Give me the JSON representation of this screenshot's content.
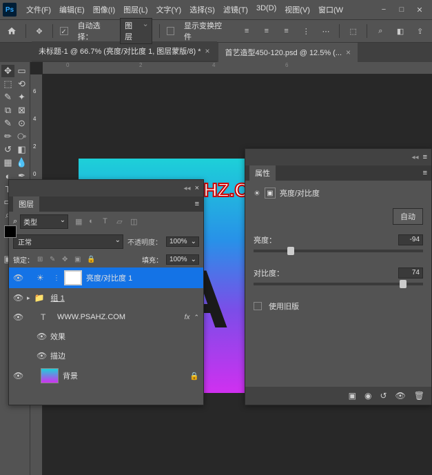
{
  "menu": {
    "file": "文件(F)",
    "edit": "编辑(E)",
    "image": "图像(I)",
    "layer": "图层(L)",
    "type": "文字(Y)",
    "select": "选择(S)",
    "filter": "滤镜(T)",
    "threeD": "3D(D)",
    "view": "视图(V)",
    "window": "窗口(W"
  },
  "options": {
    "auto_select": "自动选择：",
    "target": "图层",
    "show_transform": "显示变换控件"
  },
  "tabs": {
    "tab1": "未标题-1 @ 66.7% (亮度/对比度 1, 图层蒙版/8) *",
    "tab2": "首艺造型450-120.psd @ 12.5% (..."
  },
  "rulers_h": {
    "r0": "0",
    "r1": "2",
    "r2": "4",
    "r3": "6"
  },
  "rulers_v": {
    "r0": "0",
    "r1": "2",
    "r2": "4",
    "r3": "6"
  },
  "canvas_text": "WWW.PSAHZ.COM",
  "layers_panel": {
    "title": "图层",
    "search_kind": "类型",
    "blend": "正常",
    "opacity_label": "不透明度：",
    "opacity": "100%",
    "lock_label": "锁定：",
    "fill_label": "填充：",
    "fill": "100%",
    "layer_adj": "亮度/对比度 1",
    "layer_group": "组 1",
    "layer_text": "WWW.PSAHZ.COM",
    "fx": "fx",
    "fx_effects": "效果",
    "fx_stroke": "描边",
    "layer_bg": "背景"
  },
  "props": {
    "title": "属性",
    "adj_name": "亮度/对比度",
    "auto": "自动",
    "brightness_label": "亮度：",
    "brightness": "-94",
    "contrast_label": "对比度：",
    "contrast": "74",
    "use_old": "使用旧版"
  },
  "chart_data": null
}
